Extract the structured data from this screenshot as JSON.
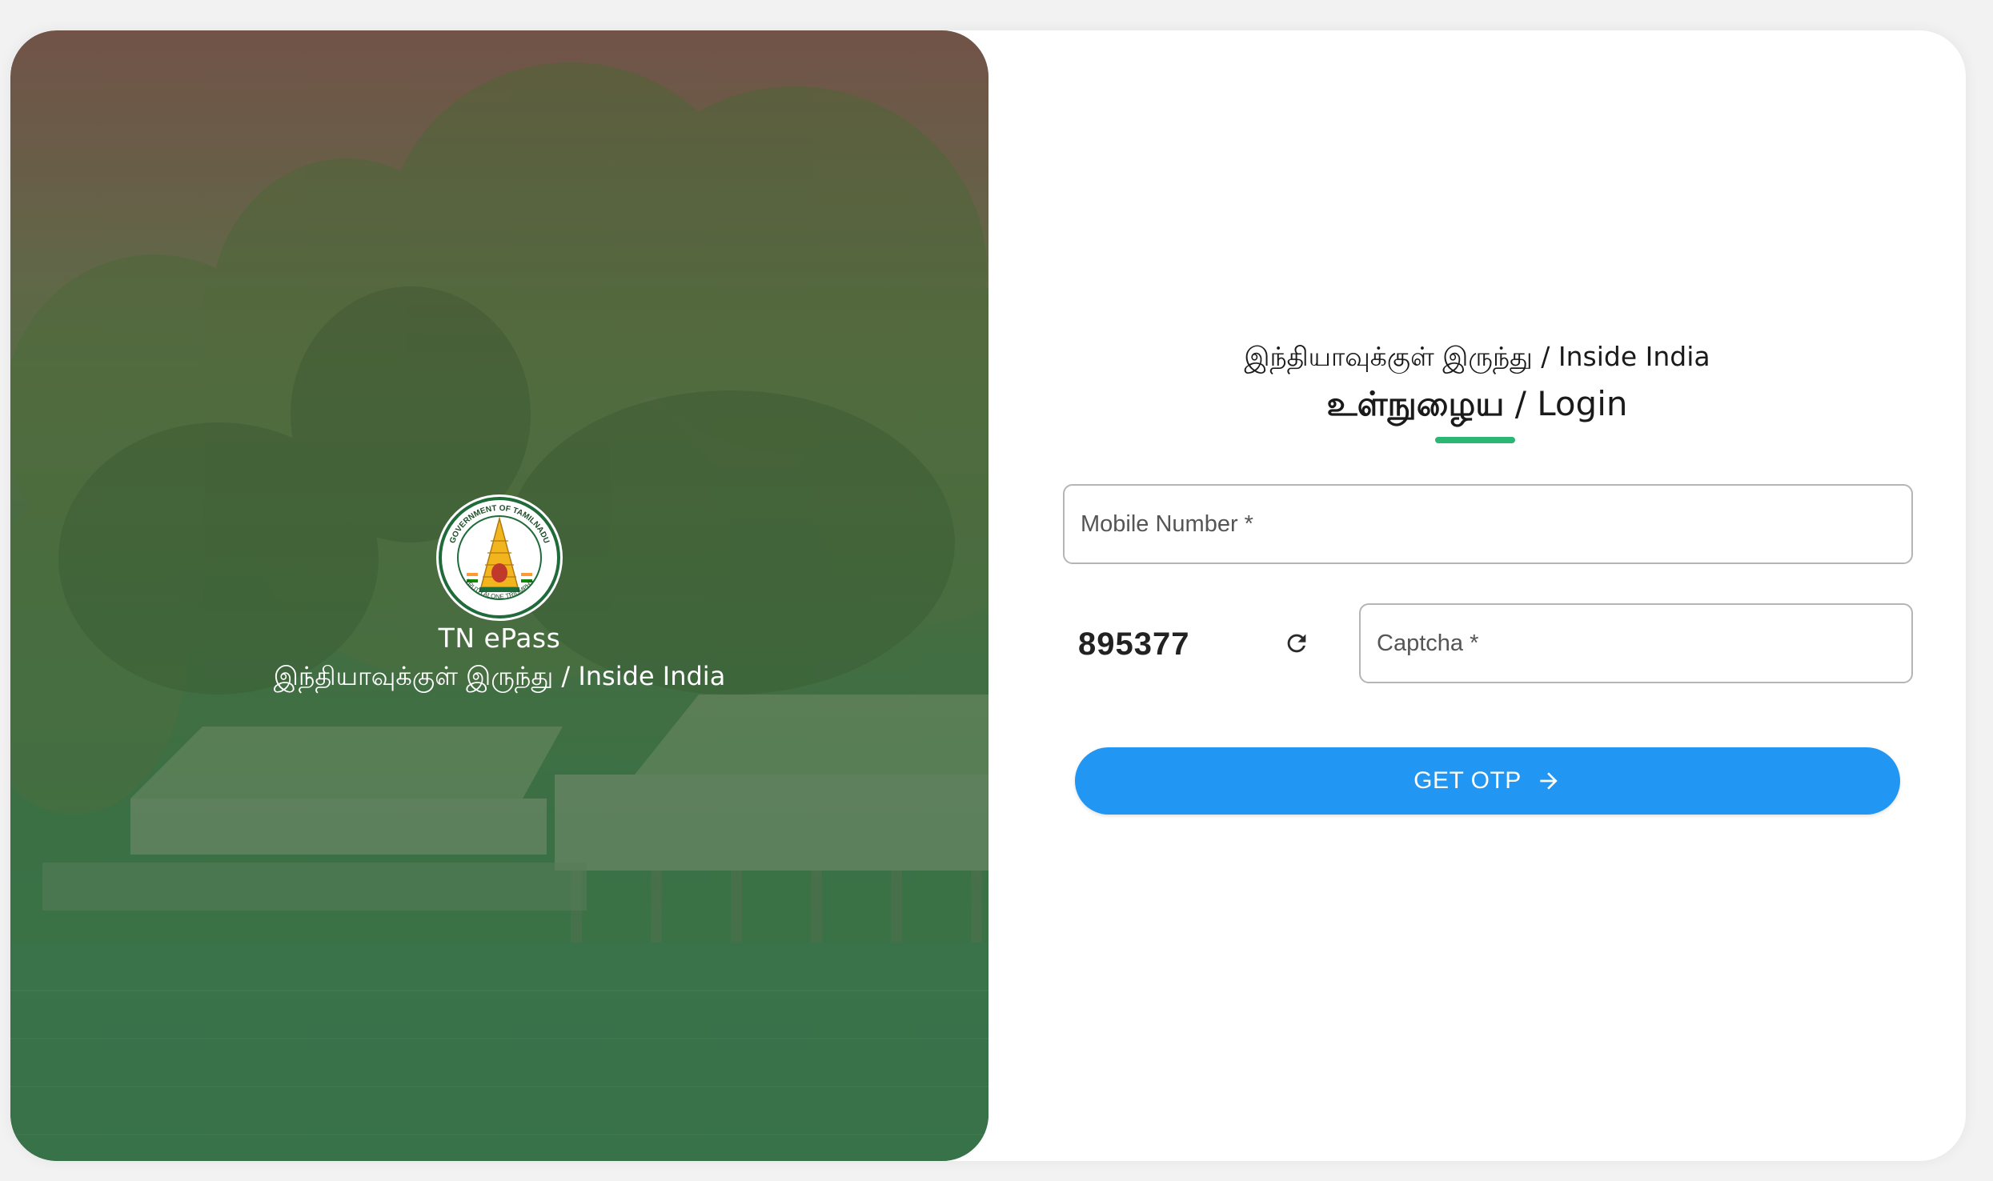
{
  "hero": {
    "app_name": "TN ePass",
    "subtitle": "இந்தியாவுக்குள் இருந்து / Inside India",
    "emblem_text_top": "GOVERNMENT OF TAMILNADU",
    "emblem_text_bottom": "TRUTH ALONE TRIUMPHS"
  },
  "form": {
    "subtitle": "இந்தியாவுக்குள் இருந்து / Inside India",
    "title_tamil": "உள்நுழைய",
    "title_separator": " / ",
    "title_english": "Login",
    "mobile_placeholder": "Mobile Number *",
    "mobile_value": "",
    "captcha_code": "895377",
    "captcha_placeholder": "Captcha *",
    "captcha_value": "",
    "otp_button_label": "GET OTP",
    "refresh_icon": "refresh-icon",
    "arrow_icon": "arrow-right-icon"
  },
  "colors": {
    "accent": "#2196f3",
    "underline": "#2bb673",
    "hero_overlay": "#3f7048"
  }
}
